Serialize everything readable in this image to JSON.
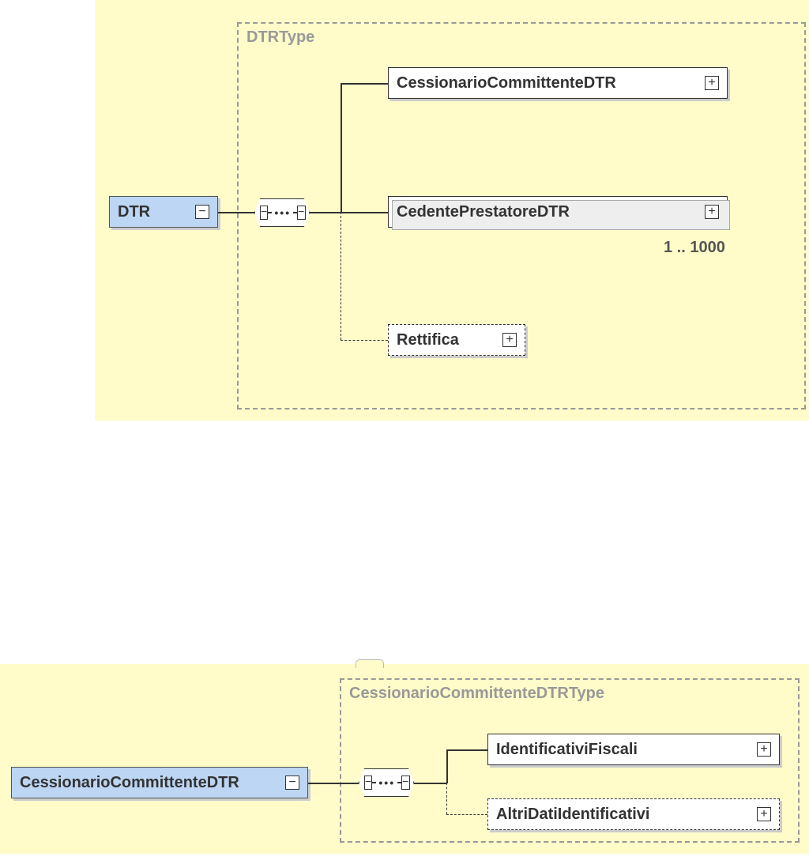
{
  "diagram1": {
    "type_label": "DTRType",
    "root": {
      "label": "DTR",
      "collapse": "−"
    },
    "sequence": {
      "left": "−",
      "right": "−"
    },
    "children": [
      {
        "label": "CessionarioCommittenteDTR",
        "expand": "+",
        "optional": false,
        "multi": false
      },
      {
        "label": "CedentePrestatoreDTR",
        "expand": "+",
        "optional": false,
        "multi": true,
        "cardinality": "1 .. 1000"
      },
      {
        "label": "Rettifica",
        "expand": "+",
        "optional": true,
        "multi": false
      }
    ]
  },
  "diagram2": {
    "type_label": "CessionarioCommittenteDTRType",
    "root": {
      "label": "CessionarioCommittenteDTR",
      "collapse": "−"
    },
    "sequence": {
      "left": "−",
      "right": "−"
    },
    "children": [
      {
        "label": "IdentificativiFiscali",
        "expand": "+",
        "optional": false
      },
      {
        "label": "AltriDatiIdentificativi",
        "expand": "+",
        "optional": true
      }
    ]
  }
}
